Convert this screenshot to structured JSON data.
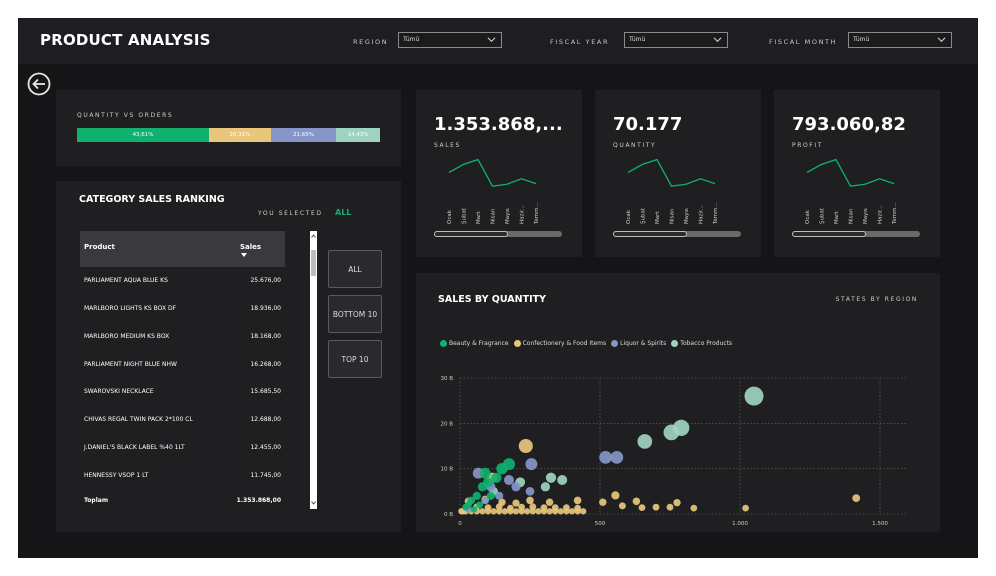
{
  "header": {
    "title": "PRODUCT ANALYSIS",
    "filters": [
      {
        "label": "REGION",
        "value": "Tümü"
      },
      {
        "label": "FISCAL YEAR",
        "value": "Tümü"
      },
      {
        "label": "FISCAL MONTH",
        "value": "Tümü"
      }
    ]
  },
  "quantity_vs_orders": {
    "title": "QUANTITY VS ORDERS",
    "segments": [
      {
        "label": "43,61%",
        "value": 43.61,
        "color": "#0fb16f"
      },
      {
        "label": "20,31%",
        "value": 20.31,
        "color": "#e8c77c"
      },
      {
        "label": "21,65%",
        "value": 21.65,
        "color": "#8696c9"
      },
      {
        "label": "14,43%",
        "value": 14.43,
        "color": "#9fd3c1"
      }
    ]
  },
  "kpis": [
    {
      "value": "1.353.868,...",
      "label": "SALES"
    },
    {
      "value": "70.177",
      "label": "QUANTITY"
    },
    {
      "value": "793.060,82",
      "label": "PROFIT"
    }
  ],
  "kpi_months": [
    "Ocak",
    "Şubat",
    "Mart",
    "Nisan",
    "Mayıs",
    "Hazir...",
    "Temm..."
  ],
  "kpi_trend": [
    0.55,
    0.8,
    0.95,
    0.12,
    0.18,
    0.35,
    0.2
  ],
  "ranking": {
    "title": "CATEGORY SALES RANKING",
    "you_selected_label": "YOU SELECTED",
    "you_selected_value": "ALL",
    "col_product": "Product",
    "col_sales": "Sales",
    "rows": [
      {
        "product": "PARLIAMENT AQUA BLUE KS",
        "sales": "25.676,00"
      },
      {
        "product": "MARLBORO LIGHTS KS BOX DF",
        "sales": "18.936,00"
      },
      {
        "product": "MARLBORO MEDIUM KS BOX",
        "sales": "18.168,00"
      },
      {
        "product": "PARLIAMENT NIGHT BLUE NHW",
        "sales": "16.268,00"
      },
      {
        "product": "SWAROVSKI NECKLACE",
        "sales": "15.685,50"
      },
      {
        "product": "CHIVAS REGAL TWIN PACK 2*100 CL",
        "sales": "12.688,00"
      },
      {
        "product": "J.DANIEL'S BLACK LABEL %40 1LT",
        "sales": "12.455,00"
      },
      {
        "product": "HENNESSY VSOP 1 LT",
        "sales": "11.745,00"
      }
    ],
    "total_label": "Toplam",
    "total_value": "1.353.868,00",
    "buttons": [
      "ALL",
      "BOTTOM 10",
      "TOP 10"
    ]
  },
  "chart_data": {
    "type": "scatter",
    "title": "SALES BY QUANTITY",
    "subtitle": "STATES BY REGION",
    "xlabel": "",
    "ylabel": "",
    "xlim": [
      0,
      1600
    ],
    "ylim": [
      0,
      30
    ],
    "x_ticks": [
      "0",
      "500",
      "1.000",
      "1.500"
    ],
    "y_ticks": [
      "0 B",
      "10 B",
      "20 B",
      "30 B"
    ],
    "grid": true,
    "legend_position": "top-left",
    "series": [
      {
        "name": "Beauty & Fragrance",
        "color": "#0fb16f",
        "points": [
          [
            175,
            11
          ],
          [
            130,
            8
          ],
          [
            100,
            7
          ],
          [
            80,
            6
          ],
          [
            60,
            4
          ],
          [
            40,
            3
          ],
          [
            30,
            2
          ],
          [
            20,
            1.5
          ],
          [
            90,
            9
          ],
          [
            150,
            10
          ],
          [
            110,
            4
          ],
          [
            70,
            2
          ],
          [
            50,
            1
          ]
        ]
      },
      {
        "name": "Confectionery & Food Items",
        "color": "#e8c77c",
        "points": [
          [
            235,
            15
          ],
          [
            115,
            8
          ],
          [
            5,
            0.6
          ],
          [
            10,
            0.6
          ],
          [
            20,
            0.6
          ],
          [
            40,
            0.6
          ],
          [
            60,
            0.6
          ],
          [
            80,
            0.6
          ],
          [
            100,
            0.6
          ],
          [
            120,
            0.6
          ],
          [
            140,
            0.6
          ],
          [
            160,
            0.6
          ],
          [
            180,
            0.6
          ],
          [
            200,
            0.6
          ],
          [
            220,
            0.6
          ],
          [
            240,
            0.6
          ],
          [
            260,
            0.6
          ],
          [
            280,
            0.6
          ],
          [
            300,
            0.6
          ],
          [
            320,
            0.6
          ],
          [
            340,
            0.6
          ],
          [
            360,
            0.6
          ],
          [
            380,
            0.6
          ],
          [
            400,
            0.6
          ],
          [
            420,
            0.6
          ],
          [
            440,
            0.6
          ],
          [
            60,
            1.6
          ],
          [
            100,
            1.4
          ],
          [
            140,
            1.6
          ],
          [
            180,
            1.3
          ],
          [
            220,
            1.5
          ],
          [
            260,
            1.6
          ],
          [
            300,
            1.4
          ],
          [
            340,
            1.4
          ],
          [
            380,
            1.4
          ],
          [
            420,
            1.3
          ],
          [
            30,
            2.8
          ],
          [
            90,
            3.2
          ],
          [
            150,
            2.6
          ],
          [
            200,
            2.4
          ],
          [
            250,
            3
          ],
          [
            320,
            2.6
          ],
          [
            420,
            3
          ],
          [
            510,
            2.6
          ],
          [
            555,
            4.1
          ],
          [
            580,
            1.8
          ],
          [
            630,
            2.8
          ],
          [
            650,
            1.4
          ],
          [
            700,
            1.5
          ],
          [
            750,
            1.5
          ],
          [
            775,
            2.5
          ],
          [
            835,
            1.3
          ],
          [
            1020,
            1.3
          ],
          [
            1415,
            3.5
          ]
        ]
      },
      {
        "name": "Liquor & Spirits",
        "color": "#8696c9",
        "points": [
          [
            255,
            11
          ],
          [
            175,
            7.5
          ],
          [
            65,
            9
          ],
          [
            110,
            6
          ],
          [
            200,
            6
          ],
          [
            250,
            5
          ],
          [
            140,
            4
          ],
          [
            90,
            3
          ],
          [
            520,
            12.5
          ],
          [
            560,
            12.5
          ],
          [
            30,
            1
          ]
        ]
      },
      {
        "name": "Tobacco Products",
        "color": "#9fd3c1",
        "points": [
          [
            1050,
            26
          ],
          [
            790,
            19
          ],
          [
            755,
            18
          ],
          [
            660,
            16
          ],
          [
            325,
            8
          ],
          [
            365,
            7.5
          ],
          [
            305,
            6
          ],
          [
            215,
            7
          ],
          [
            120,
            5
          ]
        ]
      }
    ]
  }
}
